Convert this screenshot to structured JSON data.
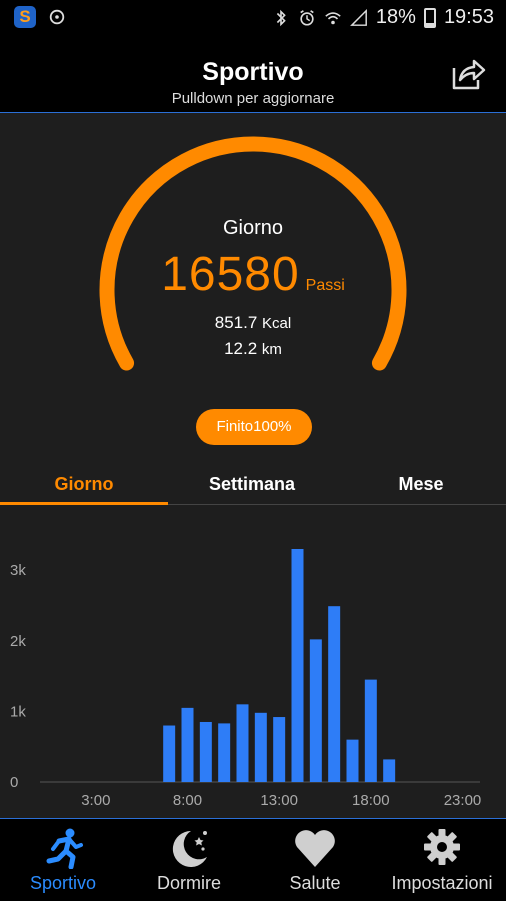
{
  "status_bar": {
    "battery": "18%",
    "time": "19:53",
    "app_badge": "S"
  },
  "header": {
    "title": "Sportivo",
    "subtitle": "Pulldown per aggiornare"
  },
  "summary": {
    "period_label": "Giorno",
    "steps": "16580",
    "steps_unit": "Passi",
    "kcal": "851.7",
    "kcal_unit": "Kcal",
    "distance": "12.2",
    "distance_unit": "km",
    "goal_button": "Finito100%",
    "progress": 1.0
  },
  "tabs": [
    {
      "label": "Giorno",
      "active": true
    },
    {
      "label": "Settimana",
      "active": false
    },
    {
      "label": "Mese",
      "active": false
    }
  ],
  "chart_data": {
    "type": "bar",
    "x_ticks": [
      "3:00",
      "8:00",
      "13:00",
      "18:00",
      "23:00"
    ],
    "y_ticks": [
      "0",
      "1k",
      "2k",
      "3k"
    ],
    "ylim": [
      0,
      3300
    ],
    "categories": [
      "7:00",
      "8:00",
      "9:00",
      "10:00",
      "11:00",
      "12:00",
      "13:00",
      "14:00",
      "15:00",
      "16:00",
      "17:00",
      "18:00",
      "19:00"
    ],
    "values": [
      800,
      1050,
      850,
      830,
      1100,
      980,
      920,
      3300,
      2020,
      2490,
      600,
      1450,
      320
    ],
    "bar_color": "#2e7df7"
  },
  "bottom_nav": [
    {
      "label": "Sportivo",
      "icon": "running-icon",
      "active": true
    },
    {
      "label": "Dormire",
      "icon": "moon-stars-icon",
      "active": false
    },
    {
      "label": "Salute",
      "icon": "heart-icon",
      "active": false
    },
    {
      "label": "Impostazioni",
      "icon": "gear-icon",
      "active": false
    }
  ],
  "colors": {
    "accent": "#ff8a00",
    "active_nav": "#2b8cff",
    "bar": "#2e7df7"
  }
}
